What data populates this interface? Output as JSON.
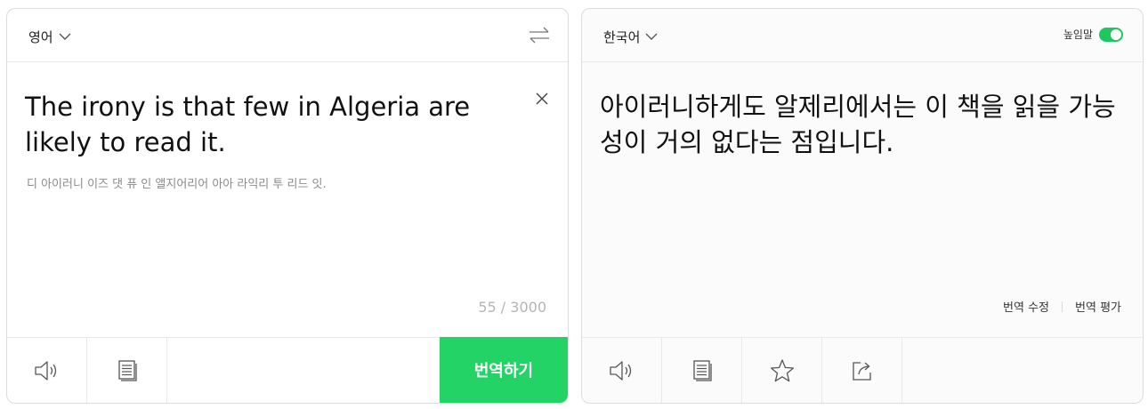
{
  "source": {
    "language": "영어",
    "text": "The irony is that few in Algeria are likely to read it.",
    "pronunciation": "디 아이러니 이즈 댓 퓨 인 앨지어리어 아아 라익리 투 리드 잇.",
    "char_count": "55 / 3000"
  },
  "target": {
    "language": "한국어",
    "text": "아이러니하게도 알제리에서는 이 책을 읽을 가능성이 거의 없다는 점입니다.",
    "honorific_label": "높임말",
    "honorific_on": true,
    "edit_translation_label": "번역 수정",
    "rate_translation_label": "번역 평가"
  },
  "actions": {
    "translate_label": "번역하기"
  },
  "colors": {
    "accent": "#23d366",
    "toggle": "#1ec85f"
  },
  "icons": [
    "chevron-down-icon",
    "swap-icon",
    "close-icon",
    "speaker-icon",
    "document-icon",
    "star-icon",
    "share-icon"
  ]
}
